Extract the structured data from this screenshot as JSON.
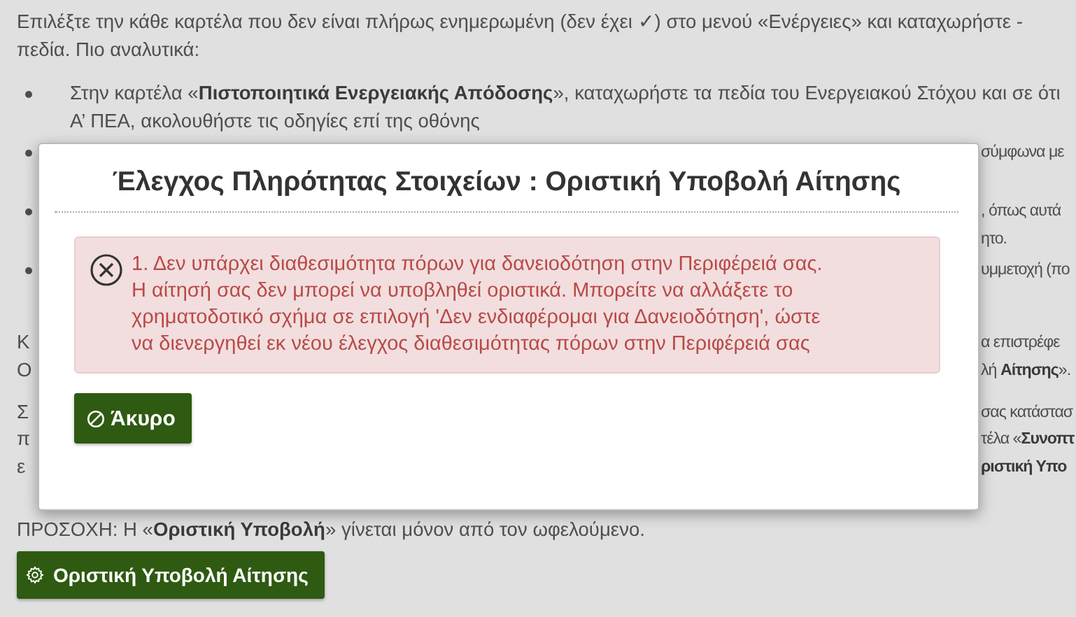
{
  "page": {
    "blocks": [
      {
        "kind": "text",
        "lines": [
          {
            "left": "Επιλέξτε την κάθε καρτέλα που δεν είναι πλήρως ενημερωμένη (δεν έχει ✓) στο μενού «Ενέργειες» και καταχωρήστε -"
          },
          {
            "left": "πεδία. Πιο αναλυτικά:"
          }
        ]
      },
      {
        "kind": "bullets",
        "items": [
          {
            "lines": [
              {
                "left": "Στην καρτέλα «**Πιστοποιητικά Ενεργειακής Απόδοσης**», καταχωρήστε τα πεδία του Ενεργειακού Στόχου και σε ότι"
              },
              {
                "left": "Α’ ΠΕΑ,  ακολουθήστε τις οδηγίες επί της οθόνης"
              }
            ]
          },
          {
            "lines": [
              {
                "right": "σύμφωνα με"
              }
            ]
          },
          {
            "lines": [
              {
                "right": ", όπως αυτά"
              },
              {
                "right": "ητο."
              }
            ]
          },
          {
            "lines": [
              {
                "right": "υμμετοχή (πο"
              }
            ]
          }
        ]
      },
      {
        "kind": "text",
        "lines": [
          {
            "left": "Κ",
            "right": "α επιστρέφε"
          },
          {
            "left": "Ο",
            "right": "λή **Αίτησης**»."
          }
        ]
      },
      {
        "kind": "text",
        "lines": [
          {
            "left": "Σ",
            "right": "σας κατάστασ"
          },
          {
            "left": "π",
            "right": "τέλα «**Συνοπτ**"
          },
          {
            "left": "ε",
            "right": "ριστική Υπο",
            "right_bold": true
          }
        ]
      },
      {
        "kind": "text",
        "lines": [
          {
            "left": "ΠΡΟΣΟΧΗ: Η «**Οριστική Υποβολή**» γίνεται μόνον από τον ωφελούμενο."
          }
        ]
      }
    ],
    "submit_button": "Οριστική Υποβολή Αίτησης"
  },
  "modal": {
    "title": "Έλεγχος Πληρότητας Στοιχείων : Οριστική Υποβολή Αίτησης",
    "error": "1. Δεν υπάρχει διαθεσιμότητα πόρων για δανειοδότηση στην Περιφέρειά σας. Η αίτησή σας δεν μπορεί να υποβληθεί οριστικά. Μπορείτε να αλλάξετε το χρηματοδοτικό σχήμα σε επιλογή 'Δεν ενδιαφέρομαι για Δανειοδότηση', ώστε να διενεργηθεί εκ νέου έλεγχος διαθεσιμότητας πόρων στην Περιφέρειά σας",
    "cancel_button": "Άκυρο"
  }
}
